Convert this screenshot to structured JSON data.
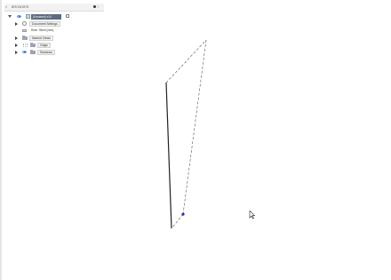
{
  "browser": {
    "title": "BROWSER",
    "root_label": "(Unsaved) v14",
    "items": [
      {
        "label": "Document Settings",
        "boxed": true
      },
      {
        "label": "Rule: Steel (mm)",
        "boxed": false
      },
      {
        "label": "Named Views",
        "boxed": true
      },
      {
        "label": "Origin",
        "boxed": true
      },
      {
        "label": "Sketches",
        "boxed": true
      }
    ]
  },
  "colors": {
    "accent": "#2a6fc9",
    "sketch_line": "#222222",
    "dashed_line": "#555555",
    "point": "#2233aa"
  },
  "icons": {
    "collapse": "double-chevron-left-icon",
    "pin": "pin-icon",
    "menu": "menu-dots-icon",
    "cursor": "mouse-pointer-icon"
  }
}
